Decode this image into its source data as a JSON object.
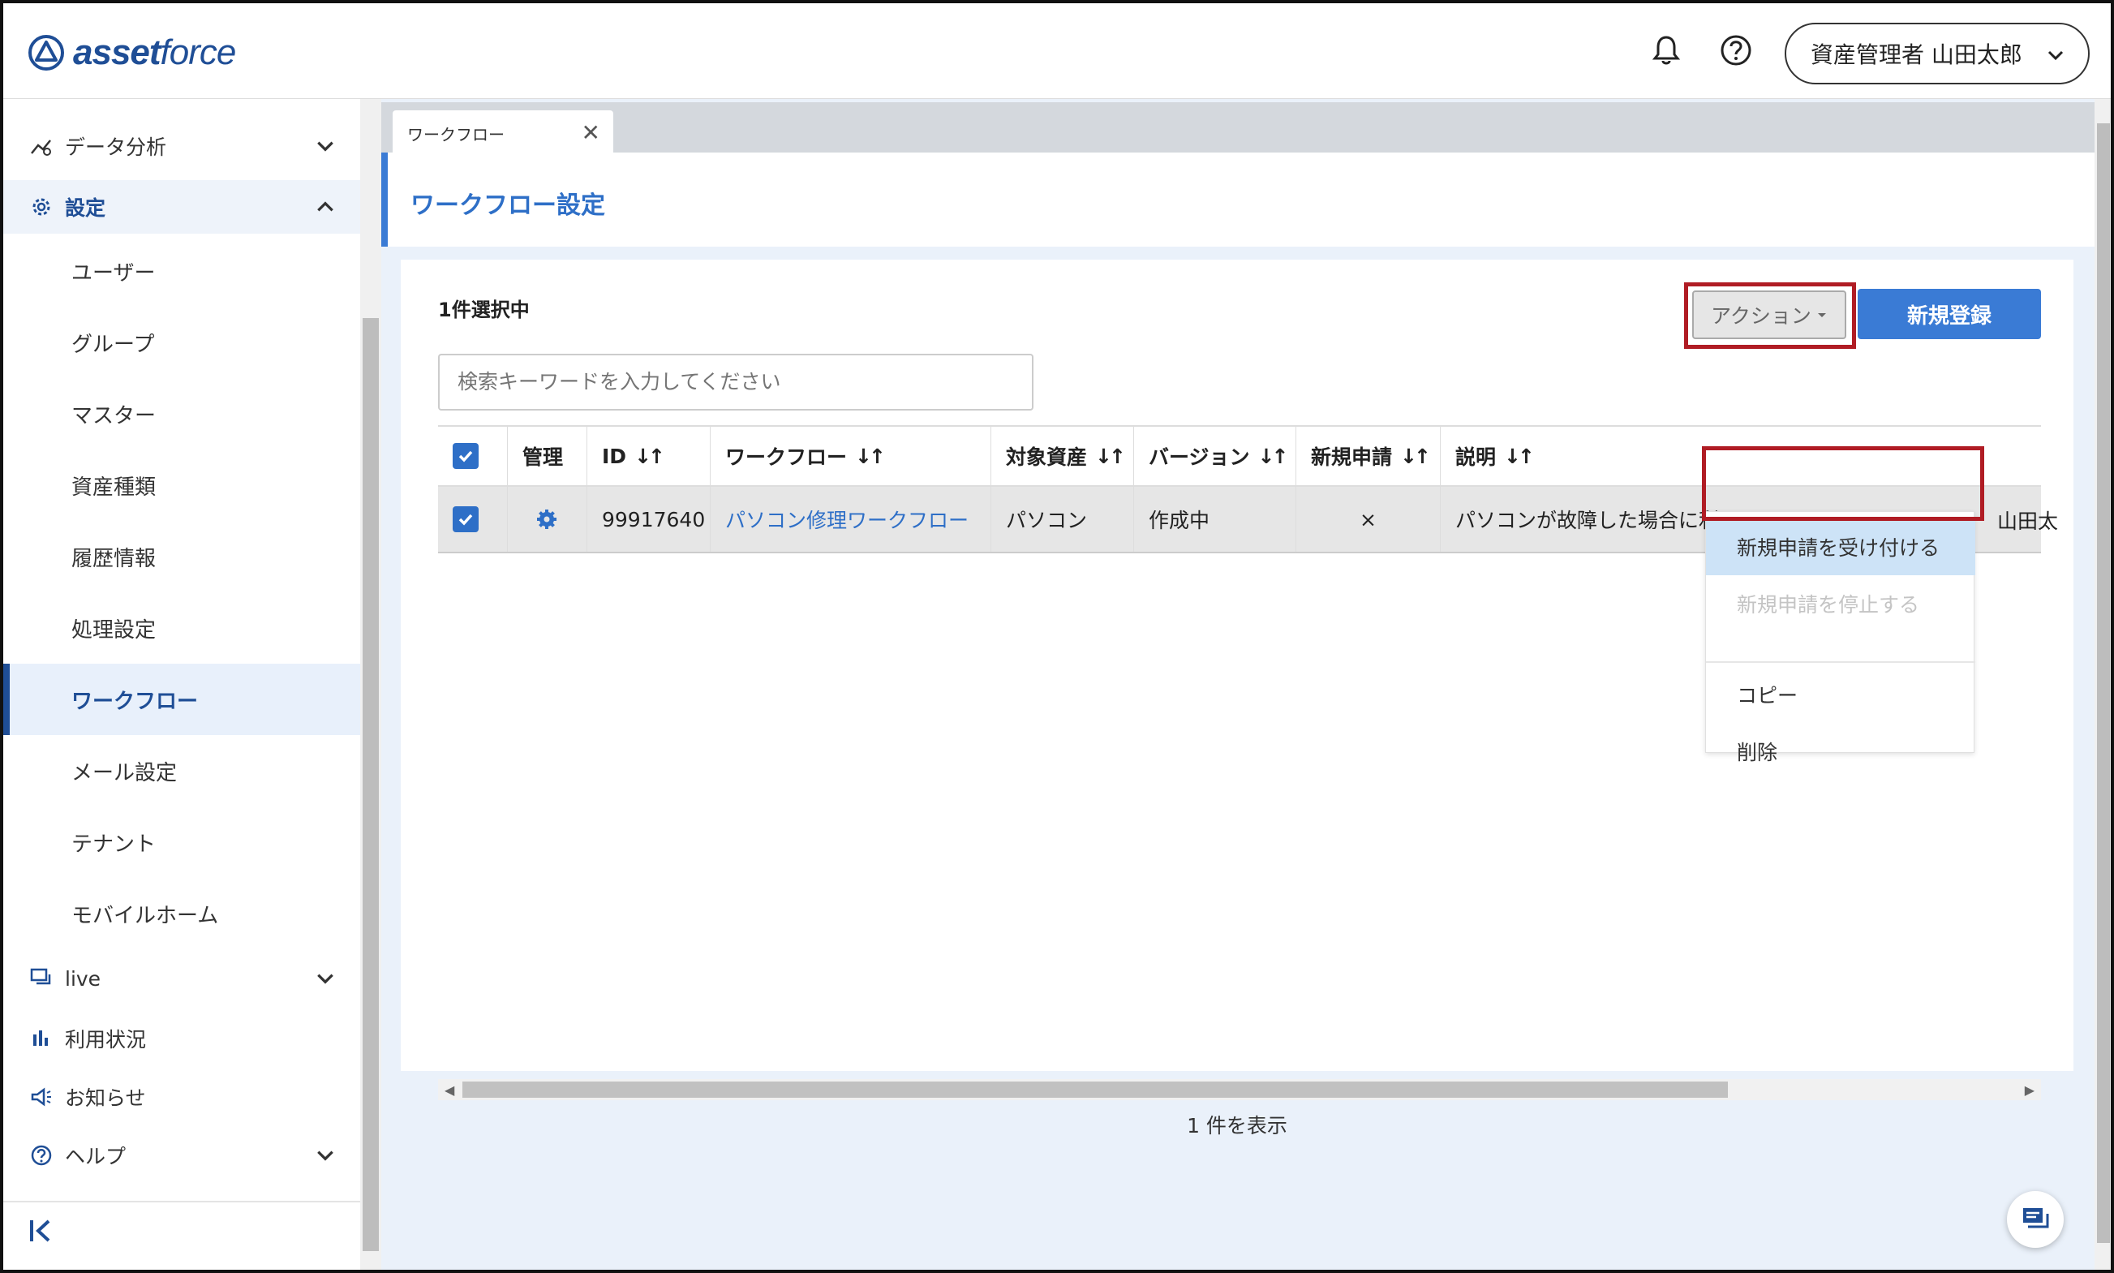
{
  "header": {
    "logo_bold": "asset",
    "logo_light": "force",
    "user_label": "資産管理者 山田太郎"
  },
  "sidebar": {
    "items": [
      {
        "label": "データ分析",
        "icon": "analytics-icon"
      },
      {
        "label": "設定",
        "icon": "gear-icon"
      },
      {
        "label": "live",
        "icon": "live-chat-icon"
      },
      {
        "label": "利用状況",
        "icon": "bar-chart-icon"
      },
      {
        "label": "お知らせ",
        "icon": "megaphone-icon"
      },
      {
        "label": "ヘルプ",
        "icon": "help-icon"
      }
    ],
    "sub_items": [
      {
        "label": "ユーザー"
      },
      {
        "label": "グループ"
      },
      {
        "label": "マスター"
      },
      {
        "label": "資産種類"
      },
      {
        "label": "履歴情報"
      },
      {
        "label": "処理設定"
      },
      {
        "label": "ワークフロー"
      },
      {
        "label": "メール設定"
      },
      {
        "label": "テナント"
      },
      {
        "label": "モバイルホーム"
      }
    ]
  },
  "tabs": [
    {
      "label": "ワークフロー",
      "close": "✕"
    }
  ],
  "page": {
    "title": "ワークフロー設定",
    "selection_count": "1件選択中",
    "search_placeholder": "検索キーワードを入力してください",
    "action_label": "アクション",
    "new_label": "新規登録",
    "shown_count": "1 件を表示"
  },
  "table": {
    "headers": [
      "管理",
      "ID",
      "ワークフロー",
      "対象資産",
      "バージョン",
      "新規申請",
      "説明"
    ],
    "rows": [
      {
        "id": "99917640",
        "workflow": "パソコン修理ワークフロー",
        "target": "パソコン",
        "version": "作成中",
        "new_request": "×",
        "description": "パソコンが故障した場合に利",
        "creator_peek": "山田太"
      }
    ]
  },
  "action_menu": {
    "items": [
      {
        "label": "新規申請を受け付ける",
        "state": "highlighted"
      },
      {
        "label": "新規申請を停止する",
        "state": "disabled"
      },
      {
        "label": "コピー",
        "state": "normal"
      },
      {
        "label": "削除",
        "state": "normal"
      }
    ]
  },
  "colors": {
    "brand": "#1f4e96",
    "accent": "#3a7bd5",
    "highlight_box": "#b01c24",
    "page_bg": "#eaf1fa"
  }
}
